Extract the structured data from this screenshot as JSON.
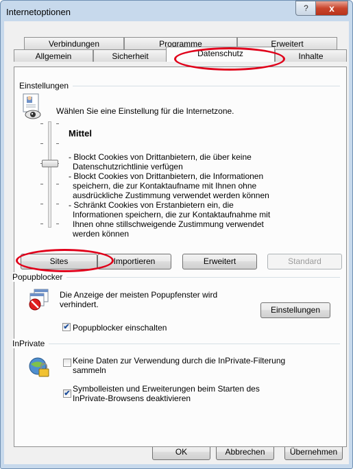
{
  "window": {
    "title": "Internetoptionen",
    "help_label": "?",
    "close_label": "x"
  },
  "tabs": {
    "row1": [
      "Verbindungen",
      "Programme",
      "Erweitert"
    ],
    "row2": [
      "Allgemein",
      "Sicherheit",
      "Datenschutz",
      "Inhalte"
    ],
    "active": "Datenschutz"
  },
  "settings": {
    "group_label": "Einstellungen",
    "zone_text": "Wählen Sie eine Einstellung für die Internetzone.",
    "level": "Mittel",
    "description": [
      "- Blockt Cookies von Drittanbietern, die über keine",
      "Datenschutzrichtlinie verfügen",
      "- Blockt Cookies von Drittanbietern, die Informationen",
      "speichern, die zur Kontaktaufname mit Ihnen ohne",
      "ausdrückliche Zustimmung verwendet werden können",
      "- Schränkt Cookies von Erstanbietern ein, die",
      "Informationen speichern, die zur Kontaktaufnahme mit",
      "Ihnen ohne stillschweigende Zustimmung verwendet",
      "werden können"
    ],
    "slider_level_index": 2,
    "slider_levels": 6,
    "buttons": {
      "sites": "Sites",
      "import": "Importieren",
      "advanced": "Erweitert",
      "default": "Standard"
    }
  },
  "popup": {
    "group_label": "Popupblocker",
    "text_line1": "Die Anzeige der meisten Popupfenster wird",
    "text_line2": "verhindert.",
    "settings_button": "Einstellungen",
    "checkbox_label": "Popupblocker einschalten",
    "checked": true
  },
  "inprivate": {
    "group_label": "InPrivate",
    "opt1_line1": "Keine Daten zur Verwendung durch die InPrivate-Filterung",
    "opt1_line2": "sammeln",
    "opt1_checked": false,
    "opt2_line1": "Symbolleisten und Erweiterungen beim Starten des",
    "opt2_line2": "InPrivate-Browsens deaktivieren",
    "opt2_checked": true
  },
  "footer": {
    "ok": "OK",
    "cancel": "Abbrechen",
    "apply": "Übernehmen"
  },
  "check_glyph": "✔",
  "highlight_color": "#e0001a"
}
